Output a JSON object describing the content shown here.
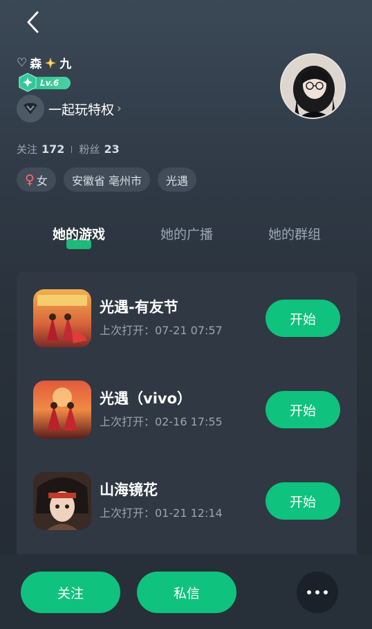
{
  "header": {
    "back_icon": "back-chevron-icon"
  },
  "profile": {
    "heart_symbol": "♡",
    "name_prefix": "森",
    "name_suffix": "九",
    "name_sparkle_icon": "sparkle-icon",
    "level": "Lv.6",
    "privilege_label": "一起玩特权",
    "stats": {
      "following_label": "关注",
      "following_count": "172",
      "followers_label": "粉丝",
      "followers_count": "23"
    },
    "tags": {
      "gender_symbol": "♀",
      "gender": "女",
      "location": "安徽省 亳州市",
      "game": "光遇"
    }
  },
  "tabs": [
    {
      "label": "她的游戏",
      "active": true
    },
    {
      "label": "她的广播",
      "active": false
    },
    {
      "label": "她的群组",
      "active": false
    }
  ],
  "games": [
    {
      "name": "光遇-有友节",
      "last_open": "上次打开：07-21 07:57",
      "start_label": "开始"
    },
    {
      "name": "光遇（vivo）",
      "last_open": "上次打开：02-16 17:55",
      "start_label": "开始"
    },
    {
      "name": "山海镜花",
      "last_open": "上次打开：01-21 12:14",
      "start_label": "开始"
    }
  ],
  "bottom_bar": {
    "follow_label": "关注",
    "message_label": "私信",
    "more_icon": "more-dots-icon"
  },
  "colors": {
    "accent": "#0fc27d",
    "level_badge": "#2fbf8d",
    "female": "#ff6b6b"
  }
}
